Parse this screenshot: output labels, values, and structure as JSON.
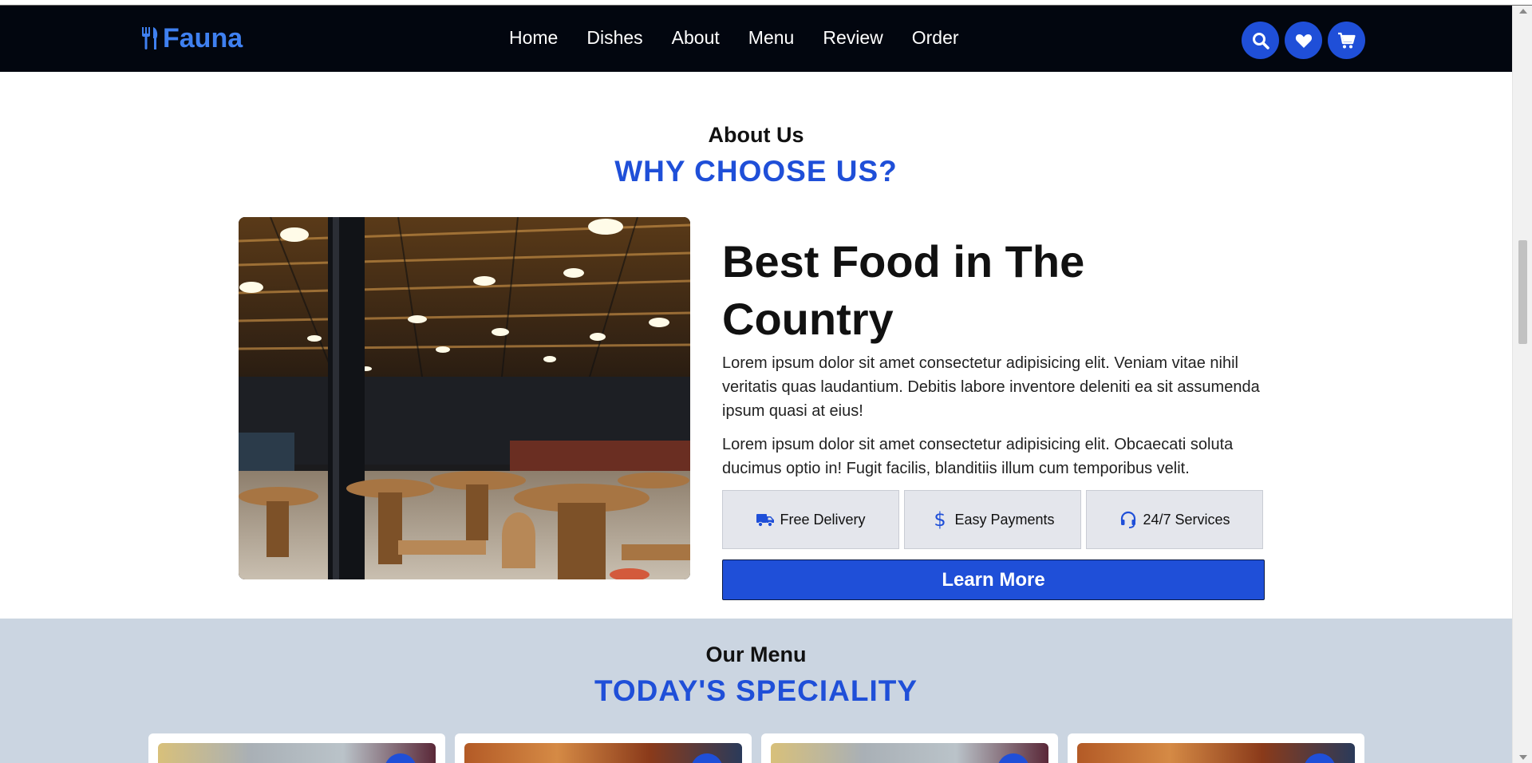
{
  "header": {
    "logo_text": "Fauna",
    "nav": [
      "Home",
      "Dishes",
      "About",
      "Menu",
      "Review",
      "Order"
    ],
    "icons": [
      "search-icon",
      "heart-icon",
      "cart-icon"
    ]
  },
  "about": {
    "subtitle": "About Us",
    "title": "WHY CHOOSE US?",
    "heading": "Best Food in The Country",
    "paragraph_1": "Lorem ipsum dolor sit amet consectetur adipisicing elit. Veniam vitae nihil veritatis quas laudantium. Debitis labore inventore deleniti ea sit assumenda ipsum quasi at eius!",
    "paragraph_2": "Lorem ipsum dolor sit amet consectetur adipisicing elit. Obcaecati soluta ducimus optio in! Fugit facilis, blanditiis illum cum temporibus velit.",
    "features": [
      {
        "icon": "truck-icon",
        "label": "Free Delivery"
      },
      {
        "icon": "dollar-icon",
        "label": "Easy Payments"
      },
      {
        "icon": "headset-icon",
        "label": "24/7 Services"
      }
    ],
    "button_label": "Learn More"
  },
  "menu": {
    "subtitle": "Our Menu",
    "title": "TODAY'S SPECIALITY"
  },
  "colors": {
    "accent": "#1f4fd8",
    "header_bg": "#02060f",
    "menu_bg": "#cbd5e1"
  }
}
